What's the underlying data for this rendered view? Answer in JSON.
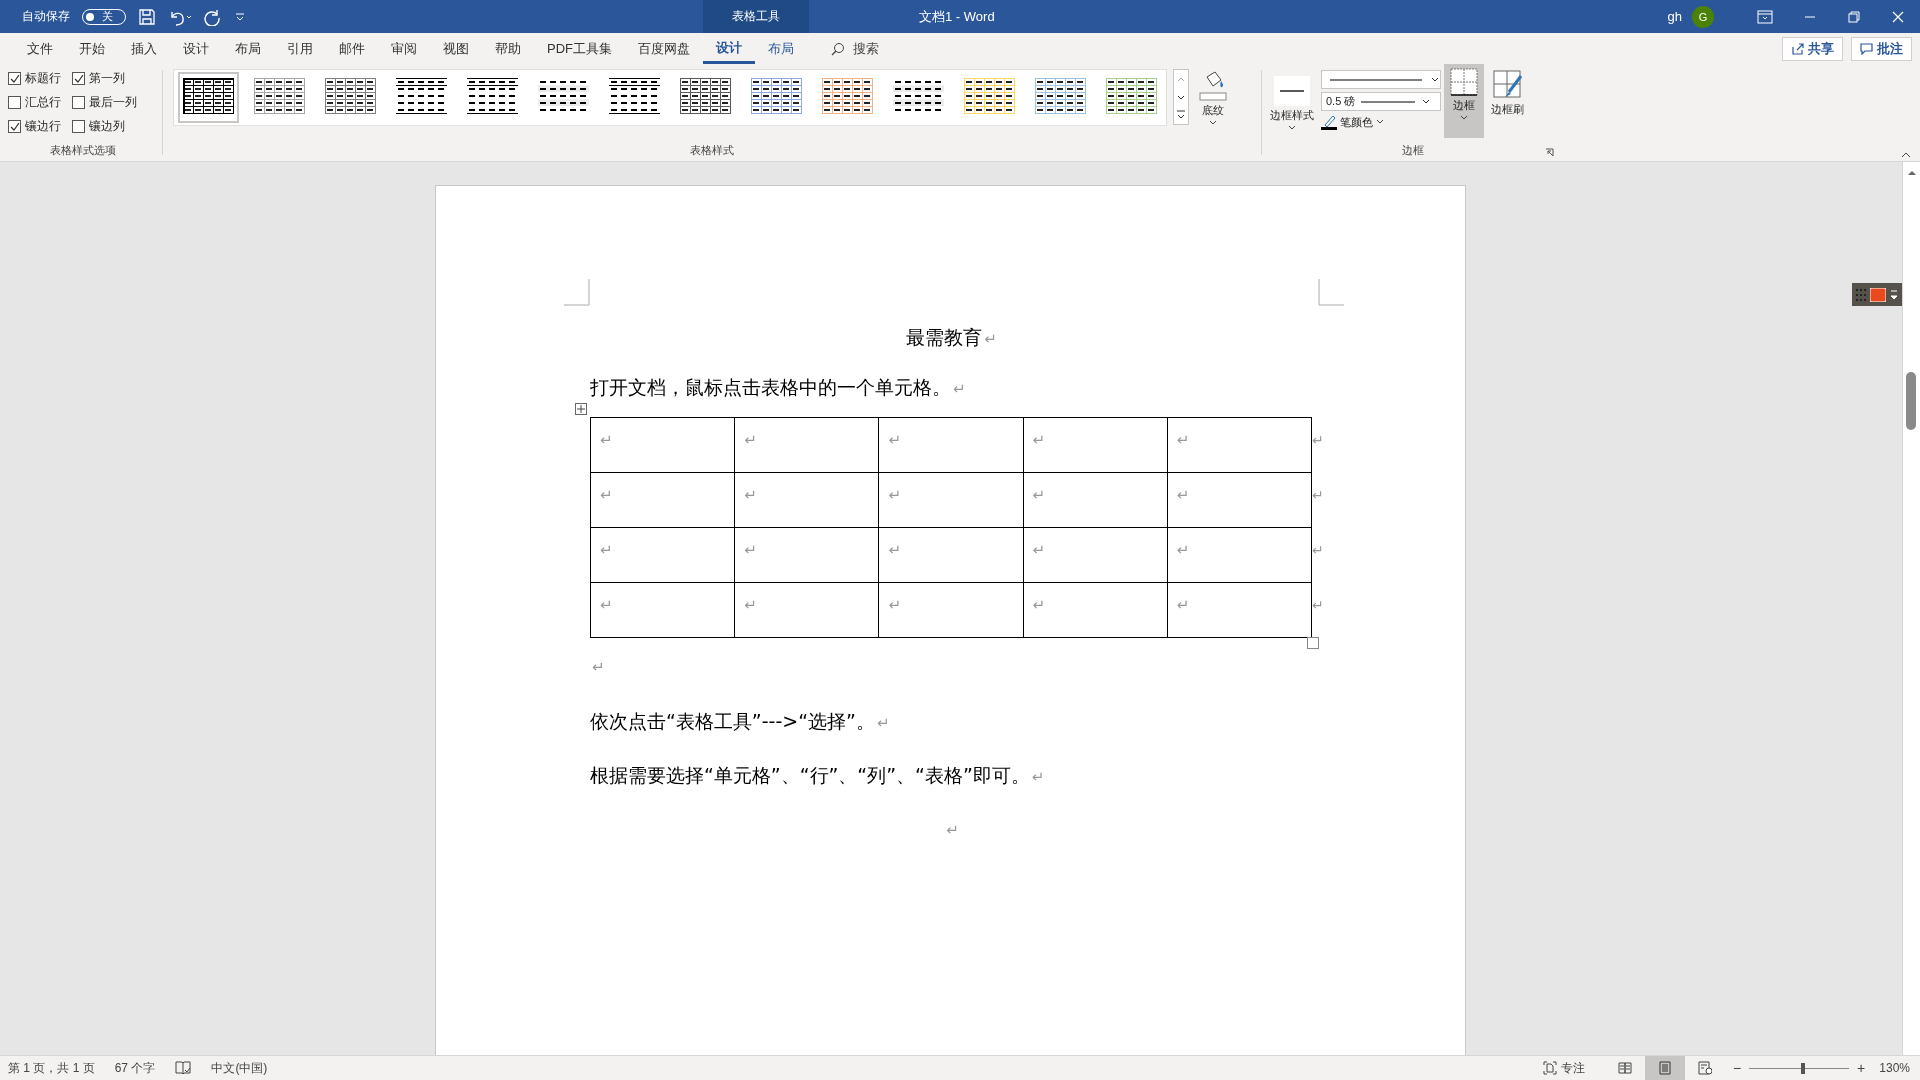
{
  "titlebar": {
    "autosave_label": "自动保存",
    "autosave": {
      "on": false,
      "label": "关"
    },
    "context_tab": "表格工具",
    "title": "文档1  -  Word",
    "user": "gh",
    "avatar": "G"
  },
  "tabs": [
    {
      "label": "文件",
      "selected": false,
      "contextual": false
    },
    {
      "label": "开始",
      "selected": false,
      "contextual": false
    },
    {
      "label": "插入",
      "selected": false,
      "contextual": false
    },
    {
      "label": "设计",
      "selected": false,
      "contextual": false
    },
    {
      "label": "布局",
      "selected": false,
      "contextual": false
    },
    {
      "label": "引用",
      "selected": false,
      "contextual": false
    },
    {
      "label": "邮件",
      "selected": false,
      "contextual": false
    },
    {
      "label": "审阅",
      "selected": false,
      "contextual": false
    },
    {
      "label": "视图",
      "selected": false,
      "contextual": false
    },
    {
      "label": "帮助",
      "selected": false,
      "contextual": false
    },
    {
      "label": "PDF工具集",
      "selected": false,
      "contextual": false
    },
    {
      "label": "百度网盘",
      "selected": false,
      "contextual": false
    },
    {
      "label": "设计",
      "selected": true,
      "contextual": true
    },
    {
      "label": "布局",
      "selected": false,
      "contextual": true
    }
  ],
  "search": {
    "label": "搜索"
  },
  "share_button": "共享",
  "comments_button": "批注",
  "style_options": {
    "label": "表格样式选项",
    "options": [
      {
        "label": "标题行",
        "checked": true
      },
      {
        "label": "第一列",
        "checked": true
      },
      {
        "label": "汇总行",
        "checked": false
      },
      {
        "label": "最后一列",
        "checked": false
      },
      {
        "label": "镶边行",
        "checked": true
      },
      {
        "label": "镶边列",
        "checked": false
      }
    ]
  },
  "table_styles": {
    "label": "表格样式",
    "items": [
      {
        "kind": "grid",
        "color": "#000000",
        "selected": true
      },
      {
        "kind": "grid",
        "color": "#a6a6a6",
        "selected": false
      },
      {
        "kind": "grid",
        "color": "#7f7f7f",
        "selected": false
      },
      {
        "kind": "lines",
        "color": "#000000",
        "selected": false
      },
      {
        "kind": "lines",
        "color": "#000000",
        "selected": false
      },
      {
        "kind": "plain",
        "color": "#000000",
        "selected": false
      },
      {
        "kind": "lines",
        "color": "#000000",
        "selected": false
      },
      {
        "kind": "grid",
        "color": "#595959",
        "selected": false
      },
      {
        "kind": "grid",
        "color": "#8eaadb",
        "selected": false
      },
      {
        "kind": "grid",
        "color": "#f4b183",
        "selected": false
      },
      {
        "kind": "plain",
        "color": "#000000",
        "selected": false
      },
      {
        "kind": "grid",
        "color": "#ffd966",
        "selected": false
      },
      {
        "kind": "grid",
        "color": "#9dc3e6",
        "selected": false
      },
      {
        "kind": "grid",
        "color": "#a9d18e",
        "selected": false
      }
    ]
  },
  "shading_button": "底纹",
  "borders": {
    "label": "边框",
    "border_styles": "边框样式",
    "pen_weight": "0.5 磅",
    "pen_color": "笔颜色",
    "borders_button": {
      "label": "边框",
      "selected": true
    },
    "border_painter": "边框刷"
  },
  "document": {
    "title": {
      "text": "最需教育",
      "mark": "↵"
    },
    "paragraph": {
      "text": "打开文档，鼠标点击表格中的一个单元格。",
      "mark": "↵"
    },
    "table": {
      "rows": [
        {
          "cells": [
            "↵",
            "↵",
            "↵",
            "↵",
            "↵"
          ],
          "end": "↵"
        },
        {
          "cells": [
            "↵",
            "↵",
            "↵",
            "↵",
            "↵"
          ],
          "end": "↵"
        },
        {
          "cells": [
            "↵",
            "↵",
            "↵",
            "↵",
            "↵"
          ],
          "end": "↵"
        },
        {
          "cells": [
            "↵",
            "↵",
            "↵",
            "↵",
            "↵"
          ],
          "end": "↵"
        }
      ]
    },
    "after_table": "↵",
    "paragraphs": [
      {
        "text": "依次点击“表格工具”--->“选择”。",
        "mark": "↵"
      },
      {
        "text": "根据需要选择“单元格”、“行”、“列”、“表格”即可。",
        "mark": "↵"
      }
    ],
    "last_mark": "↵"
  },
  "status_bar": {
    "page": "第 1 页，共 1 页",
    "words": "67 个字",
    "language": "中文(中国)",
    "focus": "专注",
    "views": [
      {
        "kind": "read",
        "selected": false
      },
      {
        "kind": "print",
        "selected": true
      },
      {
        "kind": "web",
        "selected": false
      }
    ],
    "zoom": {
      "level": 0.54,
      "label": "130%",
      "minus": "−",
      "plus": "+"
    }
  }
}
